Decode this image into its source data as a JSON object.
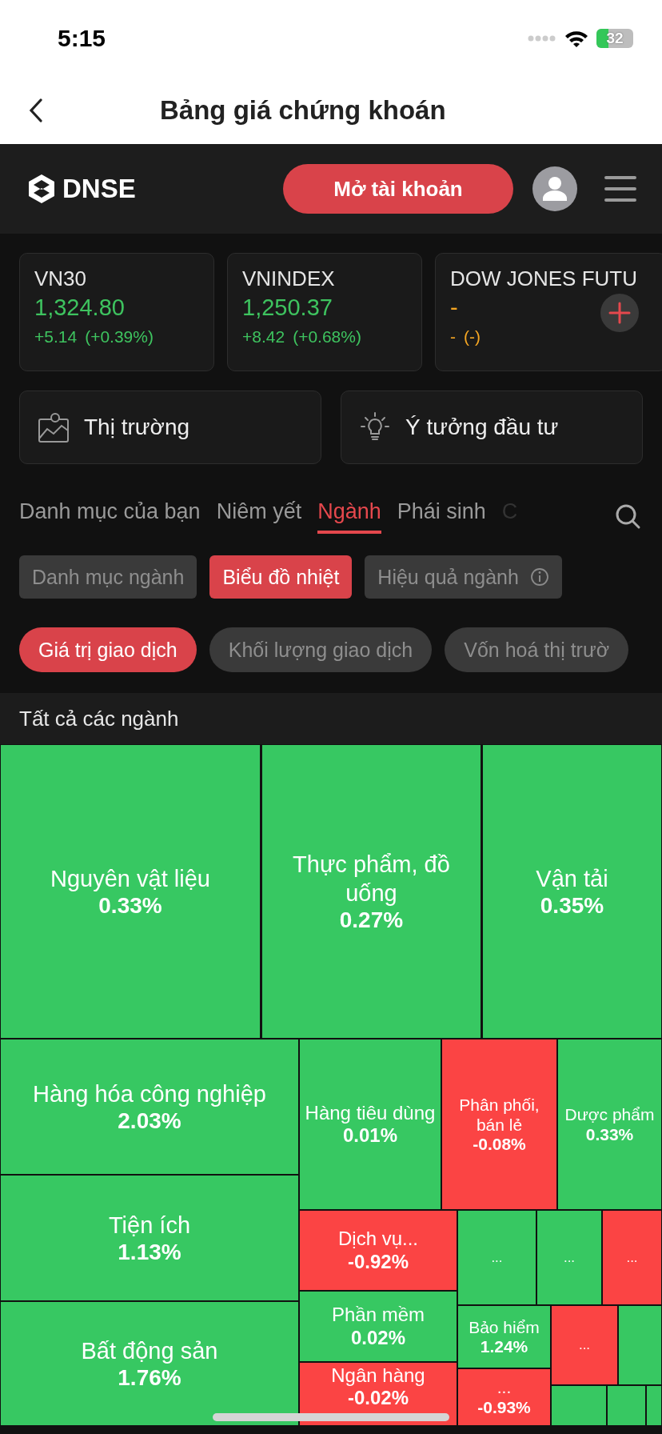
{
  "status_bar": {
    "time": "5:15",
    "battery": "32"
  },
  "nav": {
    "title": "Bảng giá chứng khoán"
  },
  "header": {
    "logo": "DNSE",
    "open_account": "Mở tài khoản"
  },
  "indices": [
    {
      "name": "VN30",
      "price": "1,324.80",
      "change": "+5.14",
      "percent": "(+0.39%)",
      "color": "#3ec35f"
    },
    {
      "name": "VNINDEX",
      "price": "1,250.37",
      "change": "+8.42",
      "percent": "(+0.68%)",
      "color": "#3ec35f"
    },
    {
      "name": "DOW JONES FUTU",
      "price": "-",
      "change": "-",
      "percent": "(-)",
      "color": "#f5a623"
    }
  ],
  "shortcuts": [
    {
      "kind": "market",
      "label": "Thị trường"
    },
    {
      "kind": "idea",
      "label": "Ý tưởng đầu tư"
    }
  ],
  "tabs": [
    {
      "label": "Danh mục của bạn",
      "selected": false
    },
    {
      "label": "Niêm yết",
      "selected": false
    },
    {
      "label": "Ngành",
      "selected": true
    },
    {
      "label": "Phái sinh",
      "selected": false
    },
    {
      "label": "C",
      "selected": false
    }
  ],
  "views": [
    {
      "label": "Danh mục ngành",
      "selected": false,
      "info": false
    },
    {
      "label": "Biểu đồ nhiệt",
      "selected": true,
      "info": false
    },
    {
      "label": "Hiệu quả ngành",
      "selected": false,
      "info": true
    }
  ],
  "metrics": [
    {
      "label": "Giá trị giao dịch",
      "selected": true
    },
    {
      "label": "Khối lượng giao dịch",
      "selected": false
    },
    {
      "label": "Vốn hoá thị trườ",
      "selected": false
    }
  ],
  "section_title": "Tất cả các ngành",
  "treemap": [
    {
      "name": "Nguyên vật liệu",
      "value": "0.33%",
      "color": "#37c862"
    },
    {
      "name": "Thực phẩm, đồ uống",
      "value": "0.27%",
      "color": "#37c862"
    },
    {
      "name": "Vận tải",
      "value": "0.35%",
      "color": "#37c862"
    },
    {
      "name": "Hàng hóa công nghiệp",
      "value": "2.03%",
      "color": "#37c862"
    },
    {
      "name": "Tiện ích",
      "value": "1.13%",
      "color": "#37c862"
    },
    {
      "name": "Bất động sản",
      "value": "1.76%",
      "color": "#37c862"
    },
    {
      "name": "Hàng tiêu dùng",
      "value": "0.01%",
      "color": "#37c862"
    },
    {
      "name": "Phân phối, bán lẻ",
      "value": "-0.08%",
      "color": "#fb4444"
    },
    {
      "name": "Dược phẩm",
      "value": "0.33%",
      "color": "#37c862"
    },
    {
      "name": "Dịch vụ...",
      "value": "-0.92%",
      "color": "#fb4444"
    },
    {
      "name": "Phần mềm",
      "value": "0.02%",
      "color": "#37c862"
    },
    {
      "name": "Ngân hàng",
      "value": "-0.02%",
      "color": "#fb4444"
    },
    {
      "name": "...",
      "color": "#37c862"
    },
    {
      "name": "...",
      "color": "#37c862"
    },
    {
      "name": "...",
      "color": "#fb4444"
    },
    {
      "name": "Bảo hiểm",
      "value": "1.24%",
      "color": "#37c862"
    },
    {
      "name": "...",
      "value": "-0.93%",
      "color": "#fb4444"
    },
    {
      "name": "...",
      "color": "#fb4444"
    },
    {
      "color": "#37c862"
    },
    {
      "color": "#37c862"
    },
    {
      "color": "#37c862"
    },
    {
      "color": "#37c862"
    }
  ]
}
